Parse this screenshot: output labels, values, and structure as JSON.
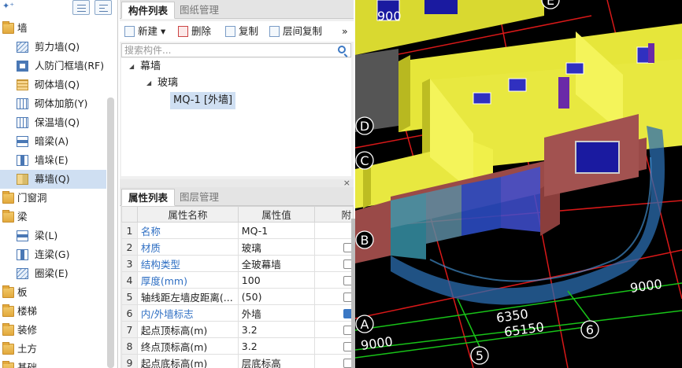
{
  "left_tree": {
    "items": [
      {
        "label": "墙",
        "kind": "folder",
        "level": 0
      },
      {
        "label": "剪力墙(Q)",
        "kind": "hatch",
        "level": 1
      },
      {
        "label": "人防门框墙(RF)",
        "kind": "frame",
        "level": 1
      },
      {
        "label": "砌体墙(Q)",
        "kind": "brick",
        "level": 1
      },
      {
        "label": "砌体加筋(Y)",
        "kind": "dash",
        "level": 1
      },
      {
        "label": "保温墙(Q)",
        "kind": "dash",
        "level": 1
      },
      {
        "label": "暗梁(A)",
        "kind": "beam",
        "level": 1
      },
      {
        "label": "墙垛(E)",
        "kind": "col",
        "level": 1
      },
      {
        "label": "幕墙(Q)",
        "kind": "curtain",
        "level": 1,
        "selected": true
      },
      {
        "label": "门窗洞",
        "kind": "folder",
        "level": 0
      },
      {
        "label": "梁",
        "kind": "folder",
        "level": 0
      },
      {
        "label": "梁(L)",
        "kind": "beam",
        "level": 1
      },
      {
        "label": "连梁(G)",
        "kind": "col",
        "level": 1
      },
      {
        "label": "圈梁(E)",
        "kind": "hatch",
        "level": 1
      },
      {
        "label": "板",
        "kind": "folder",
        "level": 0
      },
      {
        "label": "楼梯",
        "kind": "folder",
        "level": 0
      },
      {
        "label": "装修",
        "kind": "folder",
        "level": 0
      },
      {
        "label": "土方",
        "kind": "folder",
        "level": 0
      },
      {
        "label": "基础",
        "kind": "folder",
        "level": 0
      }
    ]
  },
  "component_panel": {
    "tabs": [
      "构件列表",
      "图纸管理"
    ],
    "toolbar": {
      "new": "新建",
      "delete": "删除",
      "copy": "复制",
      "floor_copy": "层间复制",
      "more": "»"
    },
    "search_placeholder": "搜索构件...",
    "tree": {
      "root": "幕墙",
      "child": "玻璃",
      "leaf": "MQ-1 [外墙]"
    }
  },
  "property_panel": {
    "tabs": [
      "属性列表",
      "图层管理"
    ],
    "close": "×",
    "headers": {
      "name": "属性名称",
      "value": "属性值",
      "attach": "附"
    },
    "rows": [
      {
        "no": "1",
        "name": "名称",
        "value": "MQ-1",
        "blue": true,
        "check": false
      },
      {
        "no": "2",
        "name": "材质",
        "value": "玻璃",
        "blue": true,
        "check": true
      },
      {
        "no": "3",
        "name": "结构类型",
        "value": "全玻幕墙",
        "blue": true,
        "check": true
      },
      {
        "no": "4",
        "name": "厚度(mm)",
        "value": "100",
        "blue": true,
        "check": true
      },
      {
        "no": "5",
        "name": "轴线距左墙皮距离(...",
        "value": "(50)",
        "blue": false,
        "check": true
      },
      {
        "no": "6",
        "name": "内/外墙标志",
        "value": "外墙",
        "blue": true,
        "check": true,
        "checked": true
      },
      {
        "no": "7",
        "name": "起点顶标高(m)",
        "value": "3.2",
        "blue": false,
        "check": true
      },
      {
        "no": "8",
        "name": "终点顶标高(m)",
        "value": "3.2",
        "blue": false,
        "check": true
      },
      {
        "no": "9",
        "name": "起点底标高(m)",
        "value": "层底标高",
        "blue": false,
        "check": true
      }
    ]
  },
  "viewport": {
    "axis_labels": [
      "A",
      "B",
      "C",
      "D",
      "E",
      "5",
      "6"
    ],
    "dimensions": [
      "9000",
      "6350",
      "65150",
      "9000",
      "900"
    ],
    "colors": {
      "wall": "#e8e840",
      "brick": "#9a4a48",
      "glass": "#4aa0e8",
      "grid_red": "#d81818",
      "grid_green": "#18c418"
    }
  }
}
